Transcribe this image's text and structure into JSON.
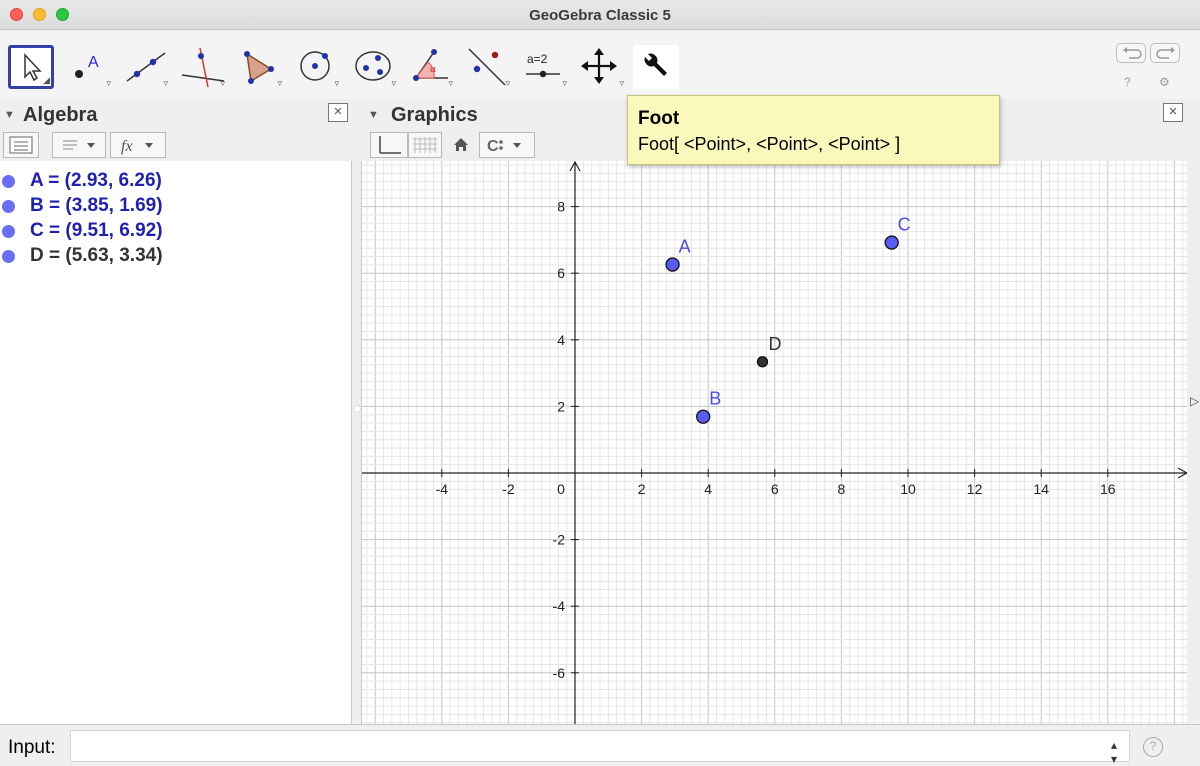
{
  "window": {
    "title": "GeoGebra Classic 5"
  },
  "toolbar": {
    "tools": [
      {
        "name": "move-tool",
        "icon": "arrow-pointer-icon",
        "selected": true
      },
      {
        "name": "point-tool",
        "icon": "point-icon",
        "label": "A"
      },
      {
        "name": "line-tool",
        "icon": "line-through-points-icon"
      },
      {
        "name": "perpendicular-tool",
        "icon": "perpendicular-line-icon"
      },
      {
        "name": "polygon-tool",
        "icon": "polygon-icon"
      },
      {
        "name": "circle-tool",
        "icon": "circle-center-point-icon"
      },
      {
        "name": "ellipse-tool",
        "icon": "conic-icon"
      },
      {
        "name": "angle-tool",
        "icon": "angle-icon",
        "label": "α"
      },
      {
        "name": "reflect-tool",
        "icon": "reflect-icon"
      },
      {
        "name": "slider-tool",
        "icon": "slider-icon",
        "label": "a=2"
      },
      {
        "name": "move-graphics-tool",
        "icon": "move-graphics-icon"
      },
      {
        "name": "customize-tool",
        "icon": "wrench-icon"
      }
    ],
    "help_glyph": "?",
    "settings_glyph": "⚙"
  },
  "tooltip": {
    "title": "Foot",
    "syntax": "Foot[ <Point>, <Point>, <Point> ]"
  },
  "algebra": {
    "title": "Algebra",
    "close": "×",
    "items": [
      {
        "text": "A = (2.93, 6.26)",
        "color": "#1f1fb4"
      },
      {
        "text": "B = (3.85, 1.69)",
        "color": "#1f1fb4"
      },
      {
        "text": "C = (9.51, 6.92)",
        "color": "#1f1fb4"
      },
      {
        "text": "D = (5.63, 3.34)",
        "color": "#333333"
      }
    ]
  },
  "graphics": {
    "title": "Graphics",
    "close": "×",
    "x_ticks": [
      "-4",
      "-2",
      "0",
      "2",
      "4",
      "6",
      "8",
      "10",
      "12",
      "14",
      "16"
    ],
    "y_ticks": [
      "8",
      "6",
      "4",
      "2",
      "-2",
      "-4",
      "-6"
    ],
    "points": [
      {
        "label": "A",
        "x": 2.93,
        "y": 6.26,
        "fill": "#5a5af5",
        "label_color": "#4a4af0"
      },
      {
        "label": "B",
        "x": 3.85,
        "y": 1.69,
        "fill": "#5a5af5",
        "label_color": "#4a4af0"
      },
      {
        "label": "C",
        "x": 9.51,
        "y": 6.92,
        "fill": "#5a5af5",
        "label_color": "#4a4af0"
      },
      {
        "label": "D",
        "x": 5.63,
        "y": 3.34,
        "fill": "#333333",
        "label_color": "#333333"
      }
    ]
  },
  "input": {
    "label": "Input:",
    "value": "",
    "placeholder": "",
    "help_glyph": "?"
  }
}
